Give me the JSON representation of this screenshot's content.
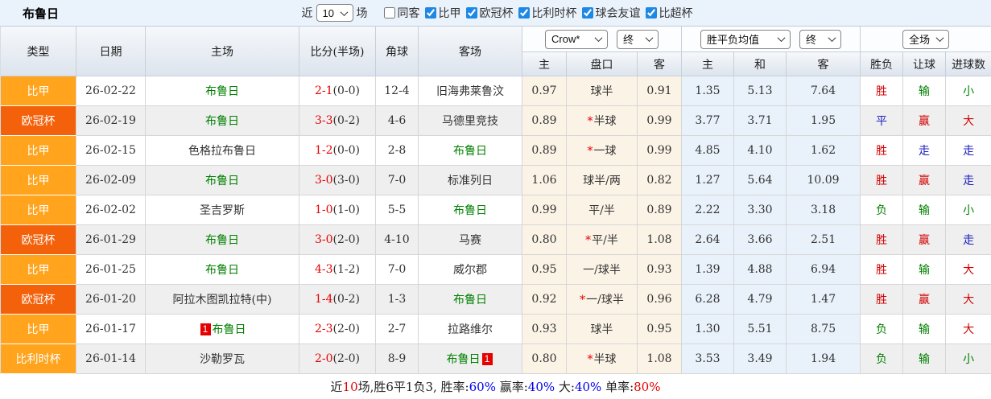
{
  "top_bar": {
    "title": "布鲁日",
    "recent_prefix": "近",
    "recent_value": "10",
    "recent_suffix": "场",
    "filters": [
      {
        "label": "同客",
        "checked": false
      },
      {
        "label": "比甲",
        "checked": true
      },
      {
        "label": "欧冠杯",
        "checked": true
      },
      {
        "label": "比利时杯",
        "checked": true
      },
      {
        "label": "球会友谊",
        "checked": true
      },
      {
        "label": "比超杯",
        "checked": true
      }
    ]
  },
  "table": {
    "col_headers": [
      "类型",
      "日期",
      "主场",
      "比分(半场)",
      "角球",
      "客场"
    ],
    "selectors": {
      "company": "Crow*",
      "company_time": "终",
      "avg": "胜平负均值",
      "avg_time": "终",
      "scope": "全场"
    },
    "subheaders": [
      "主",
      "盘口",
      "客",
      "主",
      "和",
      "客",
      "胜负",
      "让球",
      "进球数"
    ],
    "rows": [
      {
        "league": "比甲",
        "date": "26-02-22",
        "home": {
          "name": "布鲁日",
          "self": true
        },
        "score": "2-1",
        "half": "(0-0)",
        "corner": "12-4",
        "away": {
          "name": "旧海弗莱鲁汶",
          "self": false
        },
        "ah": {
          "home": "0.97",
          "line": "球半",
          "star": false,
          "away": "0.91"
        },
        "eu": {
          "home": "1.35",
          "draw": "5.13",
          "away": "7.64"
        },
        "result": {
          "text": "胜",
          "c": "red"
        },
        "handicap": {
          "text": "输",
          "c": "green"
        },
        "goal": {
          "text": "小",
          "c": "green"
        }
      },
      {
        "league": "欧冠杯",
        "date": "26-02-19",
        "home": {
          "name": "布鲁日",
          "self": true
        },
        "score": "3-3",
        "half": "(0-2)",
        "corner": "4-6",
        "away": {
          "name": "马德里竞技",
          "self": false
        },
        "ah": {
          "home": "0.89",
          "line": "半球",
          "star": true,
          "away": "0.99"
        },
        "eu": {
          "home": "3.77",
          "draw": "3.71",
          "away": "1.95"
        },
        "result": {
          "text": "平",
          "c": "blue"
        },
        "handicap": {
          "text": "赢",
          "c": "red"
        },
        "goal": {
          "text": "大",
          "c": "red"
        }
      },
      {
        "league": "比甲",
        "date": "26-02-15",
        "home": {
          "name": "色格拉布鲁日",
          "self": false
        },
        "score": "1-2",
        "half": "(0-0)",
        "corner": "2-8",
        "away": {
          "name": "布鲁日",
          "self": true
        },
        "ah": {
          "home": "0.89",
          "line": "一球",
          "star": true,
          "away": "0.99"
        },
        "eu": {
          "home": "4.85",
          "draw": "4.10",
          "away": "1.62"
        },
        "result": {
          "text": "胜",
          "c": "red"
        },
        "handicap": {
          "text": "走",
          "c": "blue"
        },
        "goal": {
          "text": "走",
          "c": "blue"
        }
      },
      {
        "league": "比甲",
        "date": "26-02-09",
        "home": {
          "name": "布鲁日",
          "self": true
        },
        "score": "3-0",
        "half": "(3-0)",
        "corner": "7-0",
        "away": {
          "name": "标准列日",
          "self": false
        },
        "ah": {
          "home": "1.06",
          "line": "球半/两",
          "star": false,
          "away": "0.82"
        },
        "eu": {
          "home": "1.27",
          "draw": "5.64",
          "away": "10.09"
        },
        "result": {
          "text": "胜",
          "c": "red"
        },
        "handicap": {
          "text": "赢",
          "c": "red"
        },
        "goal": {
          "text": "走",
          "c": "blue"
        }
      },
      {
        "league": "比甲",
        "date": "26-02-02",
        "home": {
          "name": "圣吉罗斯",
          "self": false
        },
        "score": "1-0",
        "half": "(1-0)",
        "corner": "5-5",
        "away": {
          "name": "布鲁日",
          "self": true
        },
        "ah": {
          "home": "0.99",
          "line": "平/半",
          "star": false,
          "away": "0.89"
        },
        "eu": {
          "home": "2.22",
          "draw": "3.30",
          "away": "3.18"
        },
        "result": {
          "text": "负",
          "c": "green"
        },
        "handicap": {
          "text": "输",
          "c": "green"
        },
        "goal": {
          "text": "小",
          "c": "green"
        }
      },
      {
        "league": "欧冠杯",
        "date": "26-01-29",
        "home": {
          "name": "布鲁日",
          "self": true
        },
        "score": "3-0",
        "half": "(2-0)",
        "corner": "4-10",
        "away": {
          "name": "马赛",
          "self": false
        },
        "ah": {
          "home": "0.80",
          "line": "平/半",
          "star": true,
          "away": "1.08"
        },
        "eu": {
          "home": "2.64",
          "draw": "3.66",
          "away": "2.51"
        },
        "result": {
          "text": "胜",
          "c": "red"
        },
        "handicap": {
          "text": "赢",
          "c": "red"
        },
        "goal": {
          "text": "走",
          "c": "blue"
        }
      },
      {
        "league": "比甲",
        "date": "26-01-25",
        "home": {
          "name": "布鲁日",
          "self": true
        },
        "score": "4-3",
        "half": "(1-2)",
        "corner": "7-0",
        "away": {
          "name": "威尔郡",
          "self": false
        },
        "ah": {
          "home": "0.95",
          "line": "一/球半",
          "star": false,
          "away": "0.93"
        },
        "eu": {
          "home": "1.39",
          "draw": "4.88",
          "away": "6.94"
        },
        "result": {
          "text": "胜",
          "c": "red"
        },
        "handicap": {
          "text": "输",
          "c": "green"
        },
        "goal": {
          "text": "大",
          "c": "red"
        }
      },
      {
        "league": "欧冠杯",
        "date": "26-01-20",
        "home": {
          "name": "阿拉木图凯拉特(中)",
          "self": false
        },
        "score": "1-4",
        "half": "(0-2)",
        "corner": "1-3",
        "away": {
          "name": "布鲁日",
          "self": true
        },
        "ah": {
          "home": "0.92",
          "line": "一/球半",
          "star": true,
          "away": "0.96"
        },
        "eu": {
          "home": "6.28",
          "draw": "4.79",
          "away": "1.47"
        },
        "result": {
          "text": "胜",
          "c": "red"
        },
        "handicap": {
          "text": "赢",
          "c": "red"
        },
        "goal": {
          "text": "大",
          "c": "red"
        }
      },
      {
        "league": "比甲",
        "date": "26-01-17",
        "home": {
          "name": "布鲁日",
          "self": true,
          "badge": "1",
          "badge_pos": "before"
        },
        "score": "2-3",
        "half": "(2-0)",
        "corner": "2-7",
        "away": {
          "name": "拉路维尔",
          "self": false
        },
        "ah": {
          "home": "0.93",
          "line": "球半",
          "star": false,
          "away": "0.95"
        },
        "eu": {
          "home": "1.30",
          "draw": "5.51",
          "away": "8.75"
        },
        "result": {
          "text": "负",
          "c": "green"
        },
        "handicap": {
          "text": "输",
          "c": "green"
        },
        "goal": {
          "text": "大",
          "c": "red"
        }
      },
      {
        "league": "比利时杯",
        "date": "26-01-14",
        "home": {
          "name": "沙勒罗瓦",
          "self": false
        },
        "score": "2-0",
        "half": "(2-0)",
        "corner": "8-9",
        "away": {
          "name": "布鲁日",
          "self": true,
          "badge": "1",
          "badge_pos": "after"
        },
        "ah": {
          "home": "0.80",
          "line": "半球",
          "star": true,
          "away": "1.08"
        },
        "eu": {
          "home": "3.53",
          "draw": "3.49",
          "away": "1.94"
        },
        "result": {
          "text": "负",
          "c": "green"
        },
        "handicap": {
          "text": "输",
          "c": "green"
        },
        "goal": {
          "text": "小",
          "c": "green"
        }
      }
    ]
  },
  "summary": {
    "segments": [
      {
        "t": "近",
        "c": "dark"
      },
      {
        "t": "10",
        "c": "red"
      },
      {
        "t": "场,胜6平1负3, 胜率:",
        "c": "dark"
      },
      {
        "t": "60%",
        "c": "blue"
      },
      {
        "t": " 赢率:",
        "c": "dark"
      },
      {
        "t": "40%",
        "c": "blue"
      },
      {
        "t": " 大:",
        "c": "dark"
      },
      {
        "t": "40%",
        "c": "blue"
      },
      {
        "t": " 单率:",
        "c": "dark"
      },
      {
        "t": "80%",
        "c": "red"
      }
    ]
  },
  "colors": {
    "topbar_bg": "#eaf2fb",
    "stripe": "#efefef",
    "cream": "#fbf3e6",
    "lightblue": "#e9f2fa",
    "team_green": "#008000",
    "score_red": "#e60000",
    "result_red": "#d10000",
    "result_green": "#008000",
    "result_blue": "#2020c0",
    "footer_blue": "#0000ee",
    "footer_red": "#e60000",
    "league_colors": {
      "比甲": "#ffa41c",
      "欧冠杯": "#f4610b",
      "比利时杯": "#ffa41c"
    }
  }
}
